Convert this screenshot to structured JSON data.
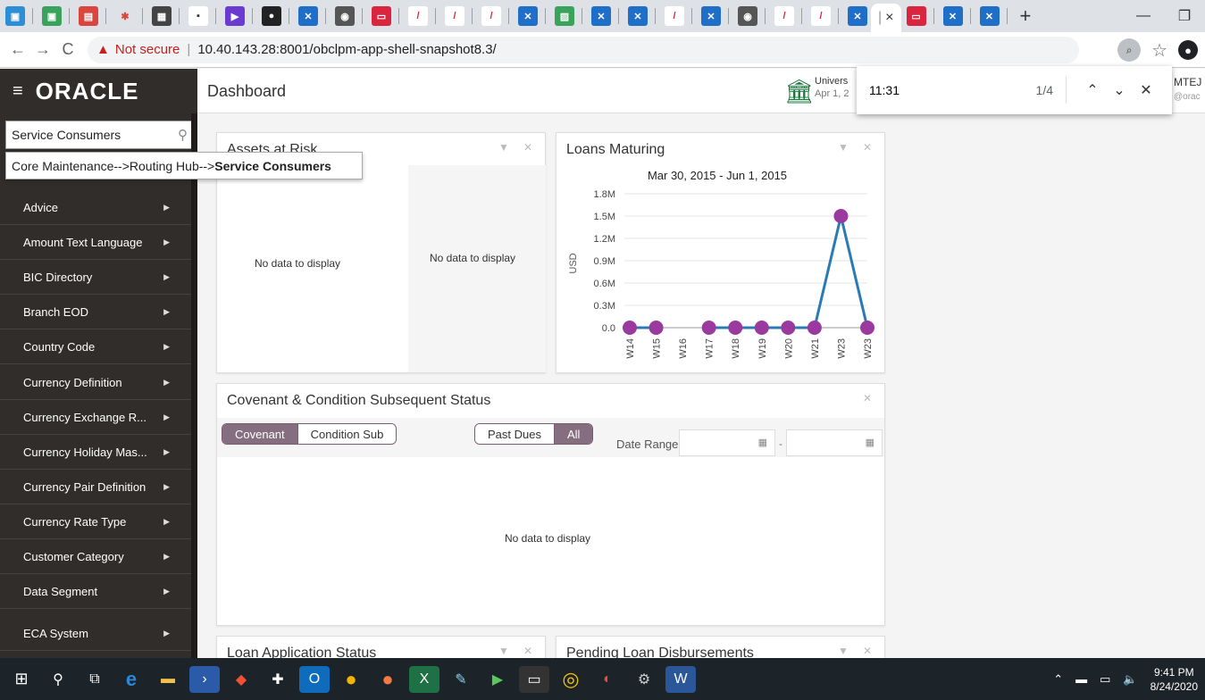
{
  "browser": {
    "active_tab_icon": "close-icon",
    "new_tab_label": "+",
    "nav": {
      "back": "←",
      "forward": "→",
      "reload": "C"
    },
    "not_secure_label": "Not secure",
    "url": "10.40.143.28:8001/obclpm-app-shell-snapshot8.3/"
  },
  "find_bar": {
    "query": "11:31",
    "count": "1/4"
  },
  "header": {
    "logo": "ORACLE",
    "page_title": "Dashboard",
    "branch_name": "Univers",
    "branch_date": "Apr 1, 2",
    "user_name": "MTEJ",
    "user_email": "@orac"
  },
  "sidebar": {
    "search_value": "Service Consumers",
    "items": [
      {
        "label": "Advice"
      },
      {
        "label": "Amount Text Language"
      },
      {
        "label": "BIC Directory"
      },
      {
        "label": "Branch EOD"
      },
      {
        "label": "Country Code"
      },
      {
        "label": "Currency Definition"
      },
      {
        "label": "Currency Exchange R..."
      },
      {
        "label": "Currency Holiday Mas..."
      },
      {
        "label": "Currency Pair Definition"
      },
      {
        "label": "Currency Rate Type"
      },
      {
        "label": "Customer Category"
      },
      {
        "label": "Data Segment"
      },
      {
        "label": "ECA System"
      }
    ]
  },
  "suggestion": {
    "path": "Core Maintenance-->Routing Hub-->",
    "match": "Service Consumers"
  },
  "cards": {
    "assets": {
      "title": "Assets at Risk",
      "nodata_left": "No data to display",
      "nodata_right": "No data to display"
    },
    "loans": {
      "title": "Loans Maturing"
    },
    "covenant": {
      "title": "Covenant & Condition Subsequent Status",
      "toggle1": [
        "Covenant",
        "Condition Sub"
      ],
      "toggle2": [
        "Past Dues",
        "All"
      ],
      "date_range_label": "Date Range",
      "date_sep": "-",
      "nodata": "No data to display"
    },
    "loan_app": {
      "title": "Loan Application Status"
    },
    "pending": {
      "title": "Pending Loan Disbursements"
    }
  },
  "chart_data": {
    "type": "line",
    "title": "Mar 30, 2015 - Jun 1, 2015",
    "ylabel": "USD",
    "categories": [
      "W14",
      "W15",
      "W16",
      "W17",
      "W18",
      "W19",
      "W20",
      "W21",
      "W23",
      "W23"
    ],
    "values": [
      0,
      0,
      null,
      0,
      0,
      0,
      0,
      0,
      1500000,
      0
    ],
    "y_ticks": [
      "0.0",
      "0.3M",
      "0.6M",
      "0.9M",
      "1.2M",
      "1.5M",
      "1.8M"
    ],
    "ylim": [
      0,
      1800000
    ],
    "line_color": "#2a7bb3",
    "marker_color": "#9b3a9e"
  },
  "taskbar": {
    "time": "9:41 PM",
    "date": "8/24/2020"
  }
}
